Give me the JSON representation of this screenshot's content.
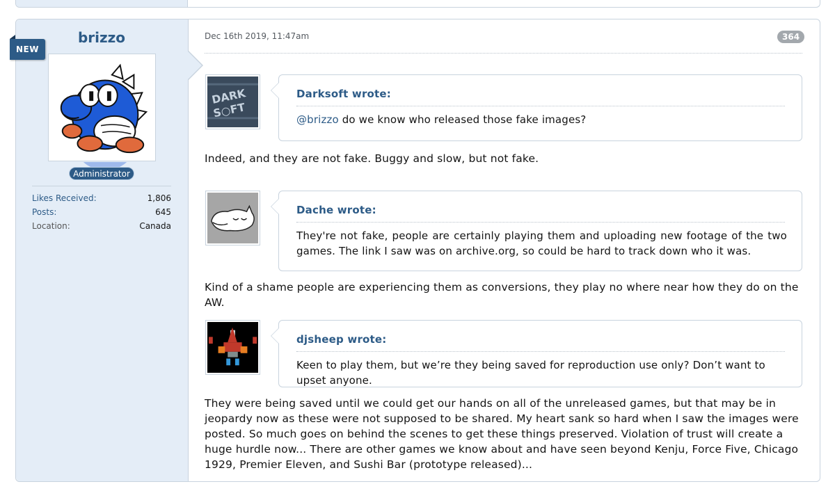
{
  "user": {
    "username": "brizzo",
    "new_badge": "NEW",
    "role": "Administrator",
    "stats": [
      {
        "label": "Likes Received:",
        "value": "1,806"
      },
      {
        "label": "Posts:",
        "value": "645"
      },
      {
        "label": "Location:",
        "value": "Canada"
      }
    ]
  },
  "post": {
    "date": "Dec 16th 2019, 11:47am",
    "number": "364",
    "quotes": [
      {
        "author": "Darksoft wrote:",
        "mention": "@brizzo",
        "text": " do we know who released those fake images?",
        "avatar_icon": "darksoft-logo-icon"
      },
      {
        "author": "Dache wrote:",
        "mention": "",
        "text": "They're not fake, people are certainly playing them and uploading new footage of the two games. The link I saw was on archive.org, so could be hard to track down who it was.",
        "avatar_icon": "sleeping-cat-icon"
      },
      {
        "author": "djsheep wrote:",
        "mention": "",
        "text": "Keen to play them, but we’re they being saved for reproduction use only? Don’t want to upset anyone.",
        "avatar_icon": "spaceship-sprite-icon"
      }
    ],
    "replies": [
      "Indeed, and they are not fake. Buggy and slow, but not fake.",
      "Kind of a shame people are experiencing them as conversions, they play no where near how they do on the AW.",
      "They were being saved until we could get our hands on all of the unreleased games, but that may be in jeopardy now as these were not supposed to be shared. My heart sank so hard when I saw the images were posted. So much goes on behind the scenes to get these things preserved. Violation of trust will create a huge hurdle now... There are other games we know about and have seen beyond Kenju, Force Five, Chicago 1929, Premier Eleven, and Sushi Bar (prototype released)..."
    ]
  },
  "colors": {
    "link": "#2d5b87",
    "sidebar": "#e4edf7",
    "border": "#c8d3de",
    "badge": "#a3a8ad"
  }
}
